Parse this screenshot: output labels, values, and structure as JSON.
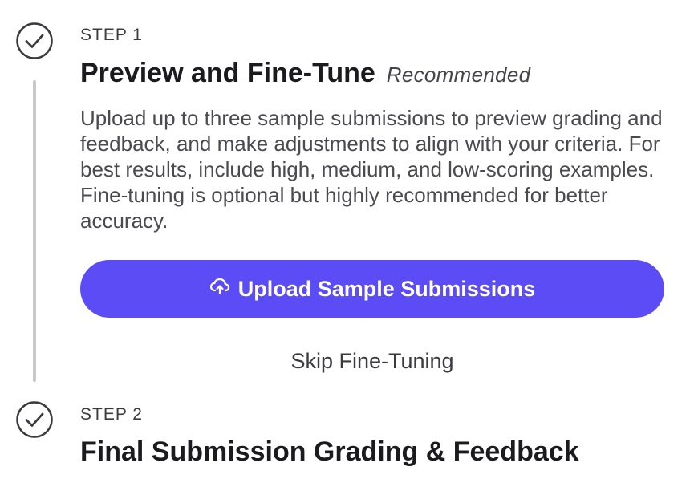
{
  "steps": [
    {
      "label": "STEP 1",
      "title": "Preview and Fine-Tune",
      "badge": "Recommended",
      "description": "Upload up to three sample submissions to preview grading and feedback, and make adjustments to align with your criteria. For best results, include high, medium, and low-scoring examples. Fine-tuning is optional but highly recommended for better accuracy.",
      "primary_action": "Upload Sample Submissions",
      "secondary_action": "Skip Fine-Tuning",
      "icon": "check-circle-icon",
      "upload_icon": "cloud-upload-icon"
    },
    {
      "label": "STEP 2",
      "title": "Final Submission Grading & Feedback",
      "icon": "check-circle-icon"
    }
  ],
  "colors": {
    "accent": "#5b4cf5",
    "timeline": "#c8c8cc",
    "text_primary": "#1a1a1f",
    "text_secondary": "#4a4a51"
  }
}
